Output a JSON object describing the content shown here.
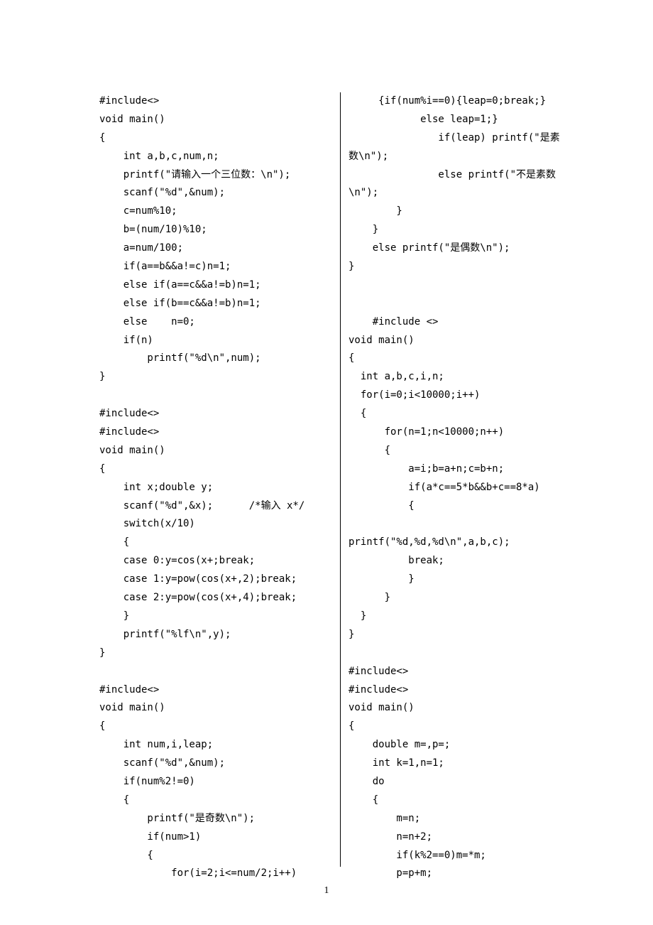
{
  "page_number": "1",
  "left_column": "#include<>\nvoid main()\n{\n    int a,b,c,num,n;\n    printf(\"请输入一个三位数：\\n\");\n    scanf(\"%d\",&num);\n    c=num%10;\n    b=(num/10)%10;\n    a=num/100;\n    if(a==b&&a!=c)n=1;\n    else if(a==c&&a!=b)n=1;\n    else if(b==c&&a!=b)n=1;\n    else    n=0;\n    if(n)\n        printf(\"%d\\n\",num);\n}\n\n#include<>\n#include<>\nvoid main()\n{\n    int x;double y;\n    scanf(\"%d\",&x);      /*输入 x*/\n    switch(x/10)\n    {\n    case 0:y=cos(x+;break;\n    case 1:y=pow(cos(x+,2);break;\n    case 2:y=pow(cos(x+,4);break;\n    }\n    printf(\"%lf\\n\",y);\n}\n\n#include<>\nvoid main()\n{\n    int num,i,leap;\n    scanf(\"%d\",&num);\n    if(num%2!=0)\n    {\n        printf(\"是奇数\\n\");\n        if(num>1)\n        {\n            for(i=2;i<=num/2;i++)",
  "right_column": "     {if(num%i==0){leap=0;break;}\n            else leap=1;}\n               if(leap) printf(\"是素\n数\\n\");\n               else printf(\"不是素数\n\\n\");\n        }\n    }\n    else printf(\"是偶数\\n\");\n}\n\n\n    #include <>\nvoid main()\n{\n  int a,b,c,i,n;\n  for(i=0;i<10000;i++)\n  {\n      for(n=1;n<10000;n++)\n      {\n          a=i;b=a+n;c=b+n;\n          if(a*c==5*b&&b+c==8*a)\n          {\n\nprintf(\"%d,%d,%d\\n\",a,b,c);\n          break;\n          }\n      }\n  }\n}\n\n#include<>\n#include<>\nvoid main()\n{\n    double m=,p=;\n    int k=1,n=1;\n    do\n    {\n        m=n;\n        n=n+2;\n        if(k%2==0)m=*m;\n        p=p+m;"
}
